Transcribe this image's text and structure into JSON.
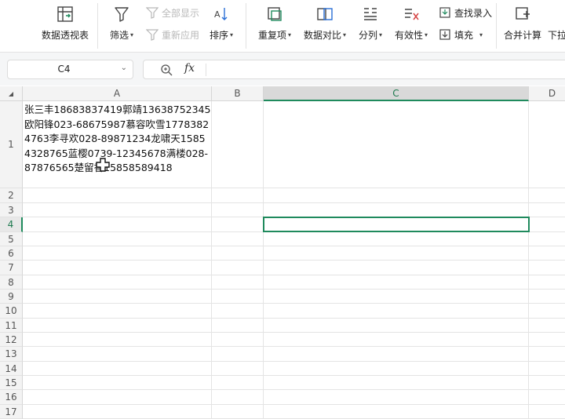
{
  "ribbon": {
    "pivot_label": "数据透视表",
    "filter_label": "筛选",
    "show_all_label": "全部显示",
    "reapply_label": "重新应用",
    "sort_label": "排序",
    "duplicates_label": "重复项",
    "compare_label": "数据对比",
    "split_label": "分列",
    "validity_label": "有效性",
    "find_entry_label": "查找录入",
    "fill_label": "填充",
    "merge_calc_label": "合并计算",
    "dropdown_label": "下拉"
  },
  "formula_bar": {
    "name_box": "C4",
    "fx_label": "fx",
    "formula": ""
  },
  "sheet": {
    "columns": [
      "A",
      "B",
      "C",
      "D"
    ],
    "selected_column": "C",
    "rows": [
      "1",
      "2",
      "3",
      "4",
      "5",
      "6",
      "7",
      "8",
      "9",
      "10",
      "11",
      "12",
      "13",
      "14",
      "15",
      "16",
      "17"
    ],
    "selected_row": "4",
    "cell_a1": "张三丰18683837419郭靖13638752345欧阳锋023-68675987慕容吹雪17783824763李寻欢028-89871234龙啸天15854328765蓝樱0739-12345678满楼028-87876565楚留香15858589418"
  },
  "colors": {
    "accent": "#1f8a5d",
    "header_bg": "#f3f3f3",
    "grid_line": "#e4e4e4"
  }
}
